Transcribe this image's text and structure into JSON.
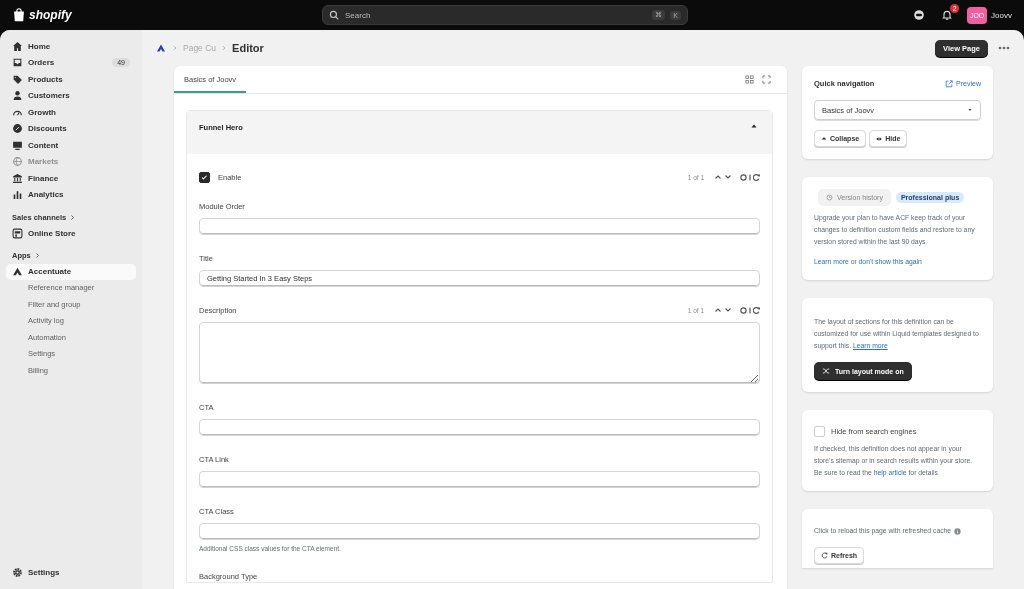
{
  "topbar": {
    "logo": "shopify",
    "search": {
      "placeholder": "Search",
      "shortcut": [
        "⌘",
        "K"
      ]
    },
    "notifications": "2",
    "user": {
      "initials": "JOO",
      "name": "Joovv"
    }
  },
  "sidebar": {
    "items": [
      {
        "label": "Home",
        "selected": false,
        "disabled": false
      },
      {
        "label": "Orders",
        "badge": "49",
        "selected": false,
        "disabled": false
      },
      {
        "label": "Products",
        "selected": false,
        "disabled": false
      },
      {
        "label": "Customers",
        "selected": false,
        "disabled": false
      },
      {
        "label": "Growth",
        "selected": false,
        "disabled": false
      },
      {
        "label": "Discounts",
        "selected": false,
        "disabled": false
      },
      {
        "label": "Content",
        "selected": false,
        "disabled": false
      },
      {
        "label": "Markets",
        "selected": false,
        "disabled": true
      },
      {
        "label": "Finance",
        "selected": false,
        "disabled": false
      },
      {
        "label": "Analytics",
        "selected": false,
        "disabled": false
      }
    ],
    "sales_channels": {
      "title": "Sales channels",
      "items": [
        {
          "label": "Online Store",
          "selected": false
        }
      ]
    },
    "apps": {
      "title": "Apps",
      "items": [
        {
          "label": "Accentuate",
          "selected": true,
          "children": [
            {
              "label": "Reference manager"
            },
            {
              "label": "Filter and group"
            },
            {
              "label": "Activity log"
            },
            {
              "label": "Automation"
            },
            {
              "label": "Settings"
            },
            {
              "label": "Billing"
            }
          ]
        }
      ]
    },
    "settings": "Settings"
  },
  "breadcrumb": {
    "items": [
      "Page Cu"
    ],
    "current": "Editor"
  },
  "header_actions": {
    "primary": "View Page"
  },
  "editor": {
    "tabs": [
      {
        "label": "Basics of Joovv",
        "selected": true
      }
    ],
    "section": {
      "title": "Funnel Hero",
      "expanded": true,
      "fields": [
        {
          "kind": "checkbox",
          "label": "Enable",
          "checked": true,
          "counter": "1 of 1"
        },
        {
          "kind": "text",
          "label": "Module Order"
        },
        {
          "kind": "text",
          "label": "Title",
          "value": "Getting Started In 3 Easy Steps"
        },
        {
          "kind": "textarea",
          "label": "Description",
          "counter": "1 of 1"
        },
        {
          "kind": "text",
          "label": "CTA"
        },
        {
          "kind": "text",
          "label": "CTA Link"
        },
        {
          "kind": "text",
          "label": "CTA Class",
          "help": "Additional CSS class values for the CTA element."
        },
        {
          "kind": "label",
          "label": "Background Type"
        }
      ]
    }
  },
  "quick_navigation": {
    "title": "Quick navigation",
    "preview": "Preview",
    "select": {
      "value": "Basics of Joovv"
    },
    "buttons": [
      "Collapse",
      "Hide"
    ]
  },
  "version_history": {
    "button": {
      "label": "Version history",
      "disabled": true
    },
    "badge": "Professional plus",
    "text": "Upgrade your plan to have ACF keep track of your changes to definition custom fields and restore to any version stored within the last 90 days",
    "links": {
      "first": "Learn more",
      "joiner": "or",
      "second": "don't show this again"
    }
  },
  "layout_mode": {
    "text": "The layout of sections for this definition can be customized for use within Liquid templates designed to support this.",
    "link": "Learn more",
    "button": "Turn layout mode on"
  },
  "seo": {
    "checkbox": {
      "label": "Hide from search engines",
      "checked": false
    },
    "text": "If checked, this definition does not appear in your store's sitemap or in search results within your store. Be sure to read the",
    "link": "help article",
    "text_after": "for details"
  },
  "cache": {
    "text": "Click to reload this page with refreshed cache",
    "button": "Refresh"
  }
}
